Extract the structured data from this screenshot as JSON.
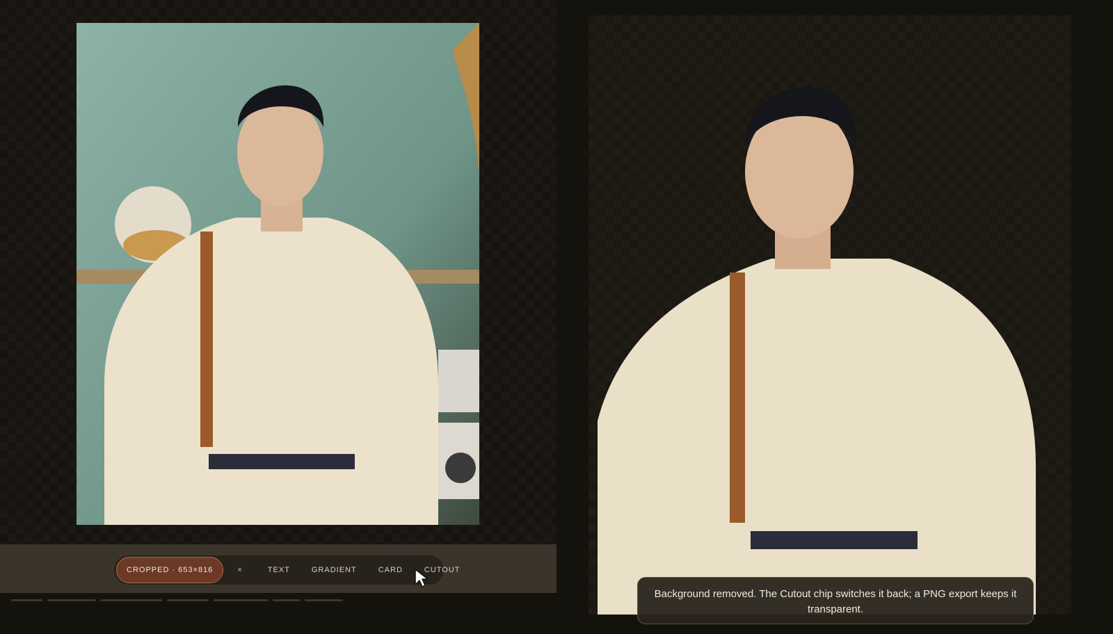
{
  "toolbar": {
    "chips": {
      "cropped": "CROPPED · 653×816",
      "clear": "×",
      "text": "TEXT",
      "gradient": "GRADIENT",
      "card": "CARD",
      "cutout": "CUTOUT"
    }
  },
  "toast": {
    "message": "Background removed. The Cutout chip switches it back; a PNG export keeps it transparent."
  },
  "colors": {
    "accent_chip": "#6a3a26",
    "accent_border": "#b4694a",
    "toolbar_bg": "#3a342b",
    "page_bg": "#14120d"
  }
}
